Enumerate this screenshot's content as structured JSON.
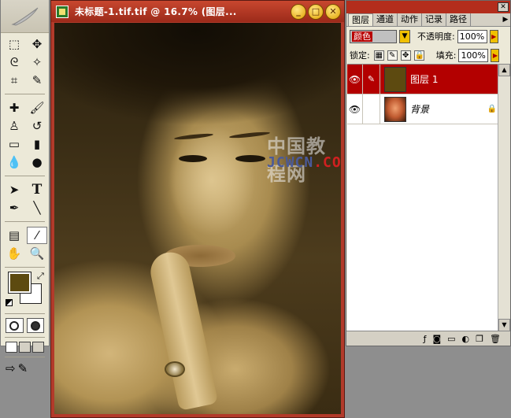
{
  "document": {
    "title": "未标题-1.tif.tif @ 16.7% (图层...",
    "controls": {
      "minimize": "_",
      "maximize": "□",
      "close": "✕"
    }
  },
  "watermark": {
    "line1": "中国教程网",
    "line2a": "JCWCN",
    "line2b": ".COM"
  },
  "toolbox": {
    "tools": [
      {
        "name": "marquee-tool",
        "icon": "⬚"
      },
      {
        "name": "move-tool",
        "icon": "✥"
      },
      {
        "name": "lasso-tool",
        "icon": "ᘓ"
      },
      {
        "name": "magic-wand-tool",
        "icon": "✧"
      },
      {
        "name": "crop-tool",
        "icon": "⌗"
      },
      {
        "name": "slice-tool",
        "icon": "✎"
      },
      {
        "name": "healing-brush-tool",
        "icon": "✚"
      },
      {
        "name": "brush-tool",
        "icon": "🖌"
      },
      {
        "name": "clone-stamp-tool",
        "icon": "♙"
      },
      {
        "name": "history-brush-tool",
        "icon": "↺"
      },
      {
        "name": "eraser-tool",
        "icon": "▭"
      },
      {
        "name": "gradient-tool",
        "icon": "▮"
      },
      {
        "name": "blur-tool",
        "icon": "💧"
      },
      {
        "name": "dodge-tool",
        "icon": "●"
      },
      {
        "name": "path-selection-tool",
        "icon": "➤"
      },
      {
        "name": "type-tool",
        "icon": "T"
      },
      {
        "name": "pen-tool",
        "icon": "✒"
      },
      {
        "name": "line-tool",
        "icon": "╲"
      },
      {
        "name": "notes-tool",
        "icon": "▤"
      },
      {
        "name": "eyedropper-tool",
        "icon": "⁄"
      },
      {
        "name": "hand-tool",
        "icon": "✋"
      },
      {
        "name": "zoom-tool",
        "icon": "🔍"
      }
    ],
    "foreground_color": "#5d4a10",
    "background_color": "#ffffff"
  },
  "layers_panel": {
    "tabs": [
      "图层",
      "通道",
      "动作",
      "记录",
      "路径"
    ],
    "blend_mode": "颜色",
    "opacity_label": "不透明度:",
    "opacity_value": "100%",
    "lock_label": "锁定:",
    "fill_label": "填充:",
    "fill_value": "100%",
    "layers": [
      {
        "name": "图层 1",
        "selected": true,
        "thumb": "fill"
      },
      {
        "name": "背景",
        "selected": false,
        "thumb": "photo",
        "locked": true
      }
    ],
    "selected_color": "#b30000"
  }
}
